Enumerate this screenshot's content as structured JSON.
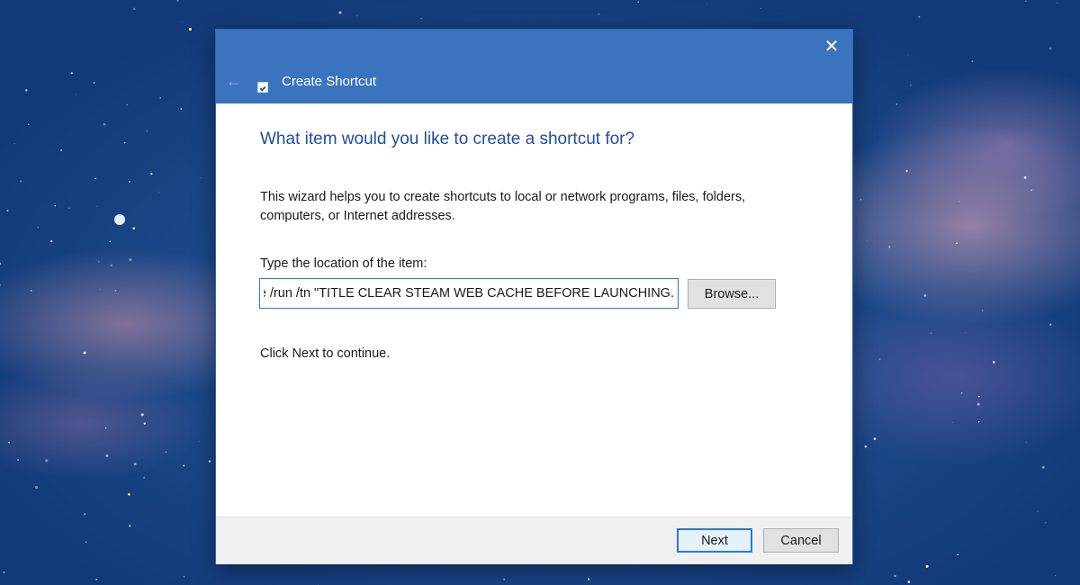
{
  "window": {
    "title": "Create Shortcut",
    "close_icon": "close-icon",
    "back_icon": "back-arrow-icon",
    "app_icon": "shortcut-icon"
  },
  "wizard": {
    "heading": "What item would you like to create a shortcut for?",
    "intro": "This wizard helps you to create shortcuts to local or network programs, files, folders, computers, or Internet addresses.",
    "location_label": "Type the location of the item:",
    "location_value": ".exe /run /tn \"TITLE CLEAR STEAM WEB CACHE BEFORE LAUNCHING\"",
    "browse_label": "Browse...",
    "continue_text": "Click Next to continue."
  },
  "footer": {
    "next_label": "Next",
    "cancel_label": "Cancel"
  },
  "colors": {
    "titlebar": "#3b74be",
    "heading": "#1f4f9e",
    "focus_border": "#2a7ad6"
  }
}
